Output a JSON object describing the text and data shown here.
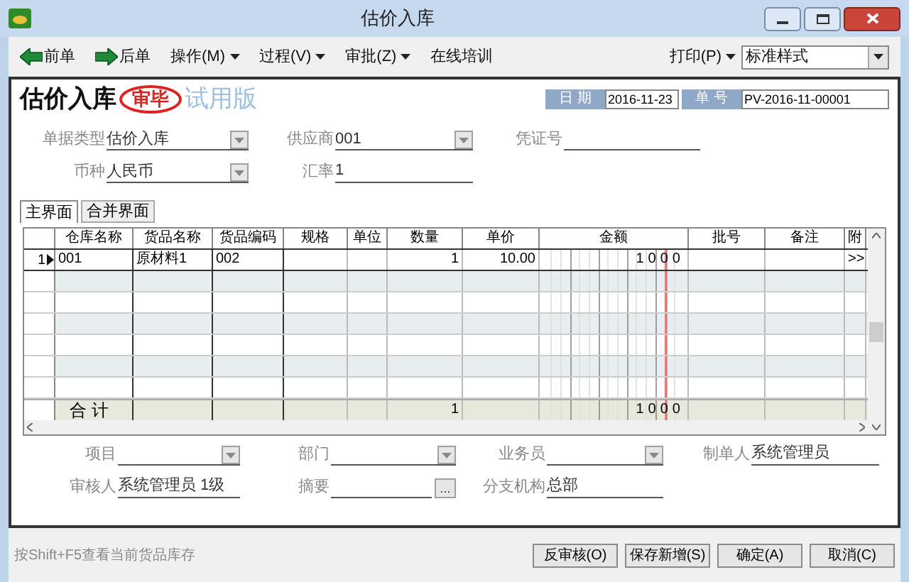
{
  "window": {
    "title": "估价入库"
  },
  "toolbar": [
    {
      "kind": "back",
      "label": "前单"
    },
    {
      "kind": "forward",
      "label": "后单"
    },
    {
      "kind": "menu",
      "label": "操作(M)"
    },
    {
      "kind": "menu",
      "label": "过程(V)"
    },
    {
      "kind": "menu",
      "label": "审批(Z)"
    },
    {
      "kind": "link",
      "label": "在线培训"
    }
  ],
  "print_menu": {
    "label": "打印(P)"
  },
  "style_select": {
    "value": "标准样式"
  },
  "header": {
    "title": "估价入库",
    "stamp": "审毕",
    "edition": "试用版",
    "date_label": "日 期",
    "date": "2016-11-23",
    "number_label": "单 号",
    "number": "PV-2016-11-00001"
  },
  "top_fields": [
    {
      "label": "单据类型",
      "value": "估价入库",
      "kind": "dropdown"
    },
    {
      "label": "供应商",
      "value": "001",
      "kind": "dropdown"
    },
    {
      "label": "凭证号",
      "kind": "text"
    },
    {
      "label": "币种",
      "value": "人民币",
      "kind": "dropdown"
    },
    {
      "label": "汇率",
      "value": "1",
      "kind": "text"
    }
  ],
  "tabs": [
    {
      "label": "主界面",
      "selected": true
    },
    {
      "label": "合并界面",
      "selected": false
    }
  ],
  "table": {
    "columns": [
      "仓库名称",
      "货品名称",
      "货品编码",
      "规格",
      "单位",
      "数量",
      "单价",
      "金额",
      "批号",
      "备注",
      "附"
    ],
    "rows": [
      {
        "number": "1",
        "selected": true,
        "cells": [
          "001",
          "原材料1",
          "002",
          "",
          "",
          "1",
          "10.00",
          "1000",
          "",
          "",
          ">>"
        ]
      }
    ],
    "total": {
      "label": "合 计",
      "cells": [
        "",
        "",
        "",
        "",
        "1",
        "",
        "1000",
        "",
        "",
        ""
      ]
    }
  },
  "bottom_fields": [
    {
      "label": "项目",
      "kind": "dropdown"
    },
    {
      "label": "部门",
      "kind": "dropdown"
    },
    {
      "label": "业务员",
      "kind": "dropdown"
    },
    {
      "label": "制单人",
      "value": "系统管理员",
      "kind": "text"
    },
    {
      "label": "审核人",
      "value": "系统管理员 1级",
      "kind": "text"
    },
    {
      "label": "摘要",
      "kind": "ellipsis",
      "button": "..."
    },
    {
      "label": "分支机构",
      "value": "总部",
      "kind": "text"
    }
  ],
  "status_bar": {
    "hint": "按Shift+F5查看当前货品库存"
  },
  "buttons": [
    "反审核(O)",
    "保存新增(S)",
    "确定(A)",
    "取消(C)"
  ]
}
